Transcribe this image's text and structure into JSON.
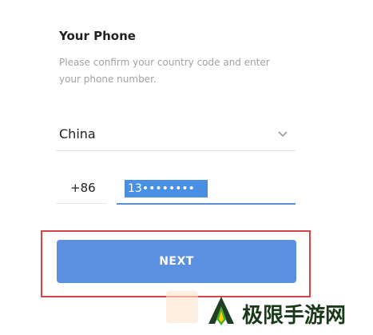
{
  "header": {
    "title": "Your Phone",
    "subtitle": "Please confirm your country code and enter your phone number."
  },
  "country": {
    "selected": "China",
    "icon": "chevron-down-icon"
  },
  "phone": {
    "country_code": "+86",
    "number": "13••••••••"
  },
  "actions": {
    "next_label": "NEXT"
  },
  "watermark": {
    "text": "极限手游网"
  },
  "colors": {
    "accent": "#5b8fe0",
    "highlight": "#d64545",
    "selection": "#4a90e2"
  }
}
